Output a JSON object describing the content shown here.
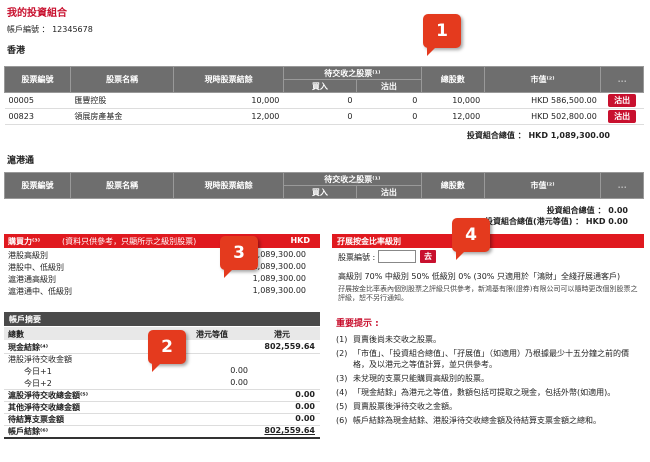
{
  "page_title": "我的投資組合",
  "account": "帳戶編號 ： 12345678",
  "hk_section": {
    "label": "香港",
    "headers": {
      "code": "股票編號",
      "name": "股票名稱",
      "settled": "現時股票結餘",
      "pending": "待交收之股票⁽¹⁾",
      "buy": "買入",
      "sell": "沽出",
      "total": "總股數",
      "market": "市值⁽²⁾",
      "action": "..."
    },
    "rows": [
      {
        "code": "00005",
        "name": "匯豐控股",
        "settled": "10,000",
        "buy": "0",
        "sell": "0",
        "total": "10,000",
        "market": "HKD 586,500.00",
        "btn": "沽出"
      },
      {
        "code": "00823",
        "name": "領展房產基金",
        "settled": "12,000",
        "buy": "0",
        "sell": "0",
        "total": "12,000",
        "market": "HKD 502,800.00",
        "btn": "沽出"
      }
    ],
    "total": "投資組合總值 ： HKD 1,089,300.00"
  },
  "sh_section": {
    "label": "滬港通",
    "headers": {
      "code": "股票編號",
      "name": "股票名稱",
      "settled": "現時股票結餘",
      "pending": "待交收之股票⁽¹⁾",
      "buy": "買入",
      "sell": "沽出",
      "total": "總股數",
      "market": "市值⁽²⁾",
      "action": "..."
    },
    "total1": "投資組合總值 ： 0.00",
    "total2": "投資組合總值(港元等值) ： HKD 0.00"
  },
  "buying_power": {
    "title": "購買力⁽³⁾",
    "note": "(資料只供參考，只顯所示之級別股票)",
    "currency": "HKD",
    "rows": [
      {
        "label": "港股高級別",
        "value": "1,089,300.00"
      },
      {
        "label": "港股中、低級別",
        "value": "1,089,300.00"
      },
      {
        "label": "滬港通高級別",
        "value": "1,089,300.00"
      },
      {
        "label": "滬港通中、低級別",
        "value": "1,089,300.00"
      }
    ]
  },
  "summary": {
    "title": "帳戶摘要",
    "col_total": "總數",
    "col_hkd_eq": "港元等值",
    "col_hkd": "港元",
    "rows": [
      {
        "label": "現金結餘⁽⁴⁾",
        "eq": "",
        "hkd": "802,559.64",
        "bold": true
      },
      {
        "label": "港股淨待交收金額",
        "eq": "",
        "hkd": "",
        "bold": false
      },
      {
        "label": "今日+1",
        "eq": "0.00",
        "hkd": "",
        "bold": false,
        "indent": true
      },
      {
        "label": "今日+2",
        "eq": "0.00",
        "hkd": "",
        "bold": false,
        "indent": true
      },
      {
        "label": "滬股淨待交收總金額⁽⁵⁾",
        "eq": "",
        "hkd": "0.00",
        "bold": true
      },
      {
        "label": "其他淨待交收總金額",
        "eq": "",
        "hkd": "0.00",
        "bold": true
      },
      {
        "label": "待結算支票金額",
        "eq": "",
        "hkd": "0.00",
        "bold": true
      },
      {
        "label": "帳戶結餘⁽⁶⁾",
        "eq": "",
        "hkd": "802,559.64",
        "bold": true
      }
    ]
  },
  "risk": {
    "title": "孖展按金比率級別",
    "input_label": "股票編號 :",
    "go": "去",
    "levels": "高級別 70% 中級別 50% 低級別 0% (30% 只適用於「鴻財」全綫孖展通客戶)",
    "note": "孖展按金比率表內個別股票之評級只供參考，新鴻基有限(證券)有限公司可以隨時更改個別股票之評級，恕不另行通知。"
  },
  "important": {
    "title": "重要提示 :",
    "items": [
      {
        "n": "(1)",
        "text": "買賣後尚未交收之股票。"
      },
      {
        "n": "(2)",
        "text": "「市值」、「投資組合總值」、「孖展值」（如適用）乃根據最少十五分鐘之前的價格，及以港元之等值計算，並只供參考。"
      },
      {
        "n": "(3)",
        "text": "未兌現的支票只能購買高級別的股票。"
      },
      {
        "n": "(4)",
        "text": "「現金結餘」為港元之等值，數額包括可提取之現金，包括外幣(如適用)。"
      },
      {
        "n": "(5)",
        "text": "買賣股票後淨待交收之金額。"
      },
      {
        "n": "(6)",
        "text": "帳戶結餘為現金結餘、港股淨待交收總金額及待結算支票金額之總和。"
      }
    ]
  },
  "badges": [
    "1",
    "2",
    "3",
    "4"
  ],
  "colors": {
    "accent": "#e0191f",
    "header_gray": "#6e6e6e",
    "badge": "#e43a1e"
  }
}
